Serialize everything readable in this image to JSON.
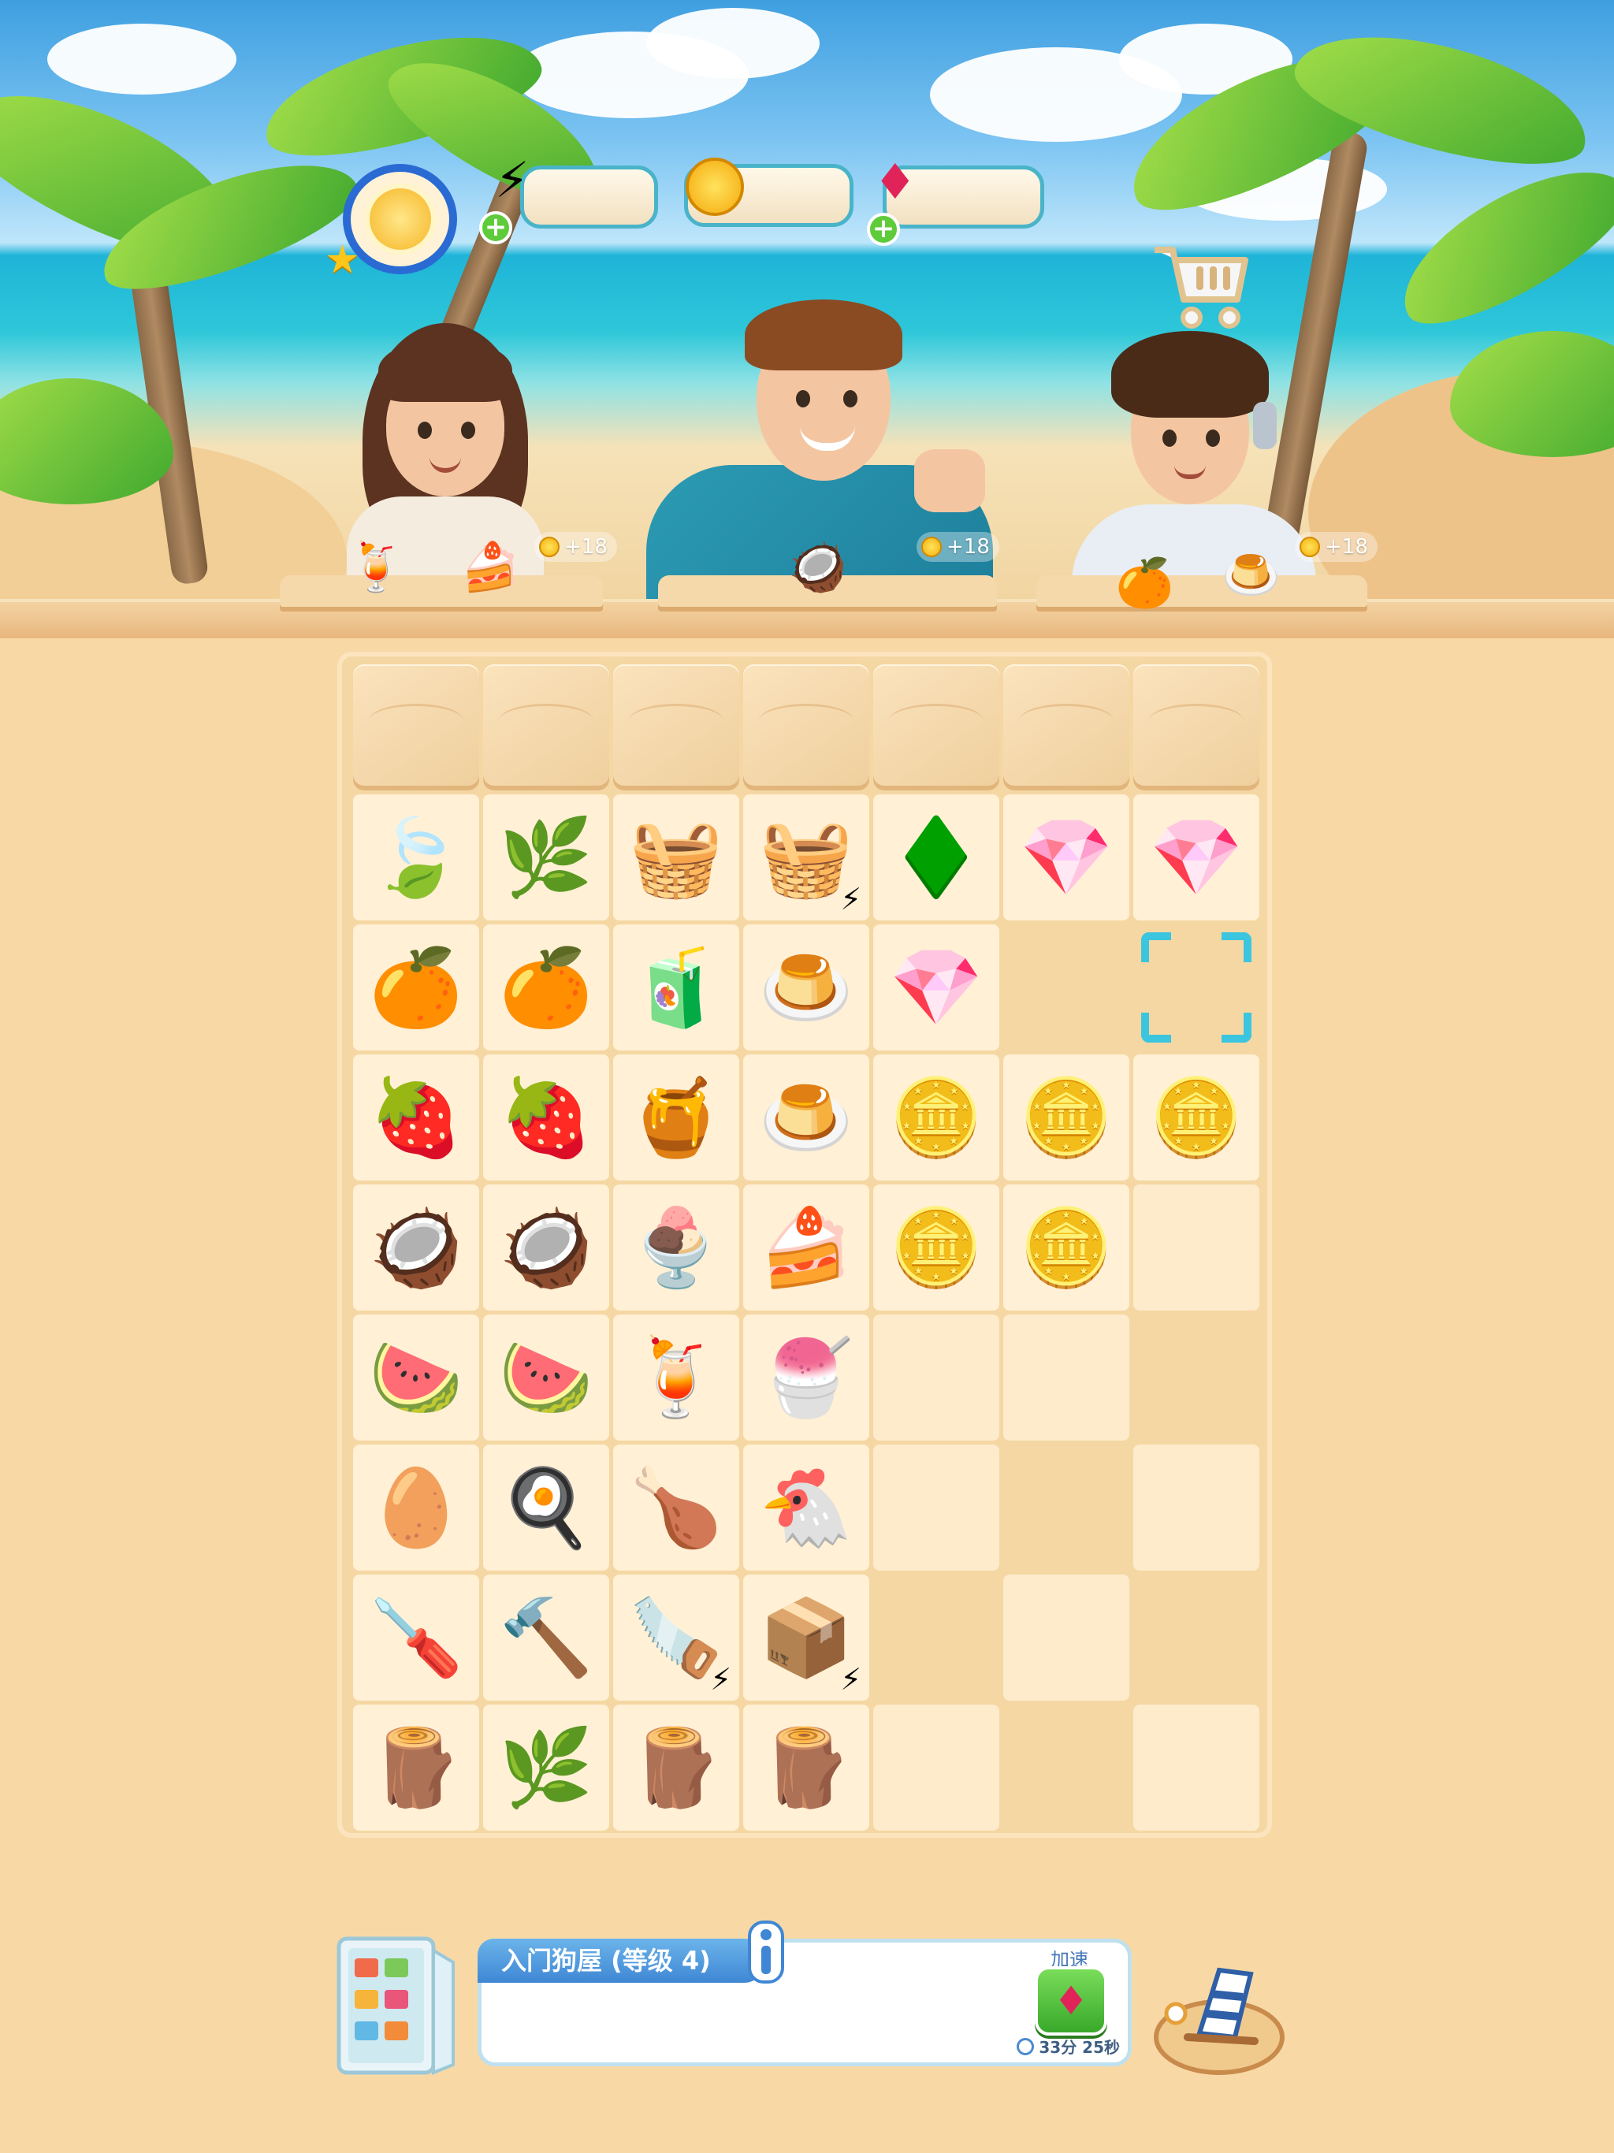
{
  "hud": {
    "level_icon": "sun-icon",
    "energy_icon": "lightning-icon",
    "coins_icon": "coin-icon",
    "gems_icon": "ruby-icon",
    "energy_value": "",
    "coins_value": "",
    "gems_value": ""
  },
  "customers": [
    {
      "name": "woman",
      "bonus": "+18",
      "order": [
        "watermelon-juice-icon",
        "cake-plate-icon"
      ]
    },
    {
      "name": "man",
      "bonus": "+18",
      "order": [
        "coconut-halves-icon"
      ]
    },
    {
      "name": "boy",
      "bonus": "+18",
      "order": [
        "orange-slice-icon",
        "pudding-plate-icon"
      ]
    }
  ],
  "board": {
    "rows": [
      [
        "sand",
        "sand",
        "sand",
        "sand",
        "sand",
        "sand",
        "sand"
      ],
      [
        "leaf",
        "leaf-nest",
        "fruit-basket",
        "picnic-basket",
        "gem-1",
        "gem-2",
        "gem-3"
      ],
      [
        "orange",
        "orange-slice",
        "orange-jelly",
        "flan",
        "gem-4",
        "blank",
        "selected"
      ],
      [
        "strawberry",
        "strawberry-half",
        "strawberry-jam",
        "pudding-plate",
        "coin-1",
        "coin-2",
        "coin-3"
      ],
      [
        "coconut",
        "coconut-halves",
        "coconut-dessert",
        "cake-plate",
        "coin-4",
        "coin-5",
        "empty"
      ],
      [
        "watermelon",
        "watermelon-slice",
        "watermelon-juice",
        "berry-bowl",
        "empty",
        "empty",
        "blank"
      ],
      [
        "egg",
        "fried-egg",
        "drumstick",
        "roast-chicken",
        "empty",
        "blank",
        "empty"
      ],
      [
        "chisel",
        "hammer",
        "saw",
        "crate",
        "blank",
        "empty",
        "blank"
      ],
      [
        "wood-plank",
        "branch",
        "log-bundle",
        "log",
        "empty",
        "blank",
        "empty"
      ]
    ],
    "items": {
      "leaf": "🍃",
      "leaf-nest": "🌿",
      "fruit-basket": "🧺",
      "picnic-basket": "🧺",
      "gem-1": "♦️",
      "gem-2": "💎",
      "gem-3": "💎",
      "gem-4": "💎",
      "orange": "🍊",
      "orange-slice": "🍊",
      "orange-jelly": "🧃",
      "flan": "🍮",
      "strawberry": "🍓",
      "strawberry-half": "🍓",
      "strawberry-jam": "🍯",
      "pudding-plate": "🍮",
      "coin-1": "🪙",
      "coin-2": "🪙",
      "coin-3": "🪙",
      "coin-4": "🪙",
      "coin-5": "🪙",
      "coconut": "🥥",
      "coconut-halves": "🥥",
      "coconut-dessert": "🍨",
      "cake-plate": "🍰",
      "watermelon": "🍉",
      "watermelon-slice": "🍉",
      "watermelon-juice": "🍹",
      "berry-bowl": "🍧",
      "egg": "🥚",
      "fried-egg": "🍳",
      "drumstick": "🍗",
      "roast-chicken": "🐔",
      "chisel": "🪛",
      "hammer": "🔨",
      "saw": "🪚",
      "crate": "📦",
      "wood-plank": "🪵",
      "branch": "🌿",
      "log-bundle": "🪵",
      "log": "🪵"
    },
    "generators": [
      "picnic-basket",
      "saw",
      "crate"
    ]
  },
  "task": {
    "title": "入门狗屋 (等级 4)",
    "speed_up_label": "加速",
    "timer": "33分 25秒"
  },
  "icons": {
    "fridge": "fridge-icon",
    "beach_chair": "beach-chair-icon",
    "cart": "shopping-cart-icon",
    "info": "info-icon"
  }
}
